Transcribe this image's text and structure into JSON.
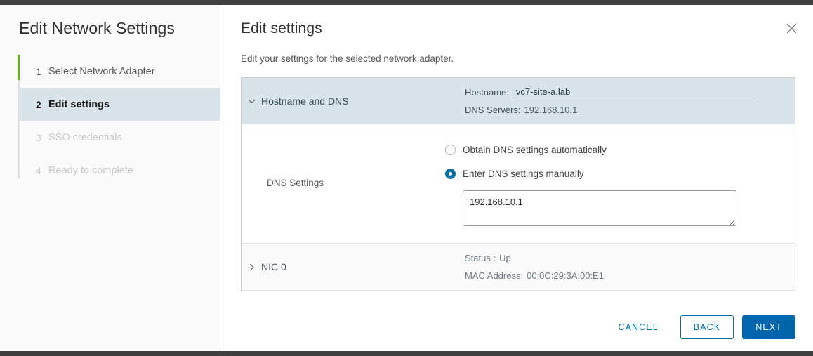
{
  "window": {
    "close_icon": "close-icon"
  },
  "wizard": {
    "title": "Edit Network Settings",
    "steps": [
      {
        "num": "1",
        "label": "Select Network Adapter",
        "state": "done"
      },
      {
        "num": "2",
        "label": "Edit settings",
        "state": "active"
      },
      {
        "num": "3",
        "label": "SSO credentials",
        "state": "upcoming"
      },
      {
        "num": "4",
        "label": "Ready to complete",
        "state": "upcoming"
      }
    ]
  },
  "content": {
    "title": "Edit settings",
    "subtitle": "Edit your settings for the selected network adapter."
  },
  "sections": {
    "hostname_dns": {
      "label": "Hostname and DNS",
      "caret_icon": "chevron-down-icon",
      "expanded": true,
      "hostname_key": "Hostname:",
      "hostname_value": "vc7-site-a.lab",
      "dns_servers_key": "DNS Servers:",
      "dns_servers_value": "192.168.10.1",
      "body": {
        "label": "DNS Settings",
        "options": [
          {
            "label": "Obtain DNS settings automatically",
            "selected": false
          },
          {
            "label": "Enter DNS settings manually",
            "selected": true
          }
        ],
        "dns_value": "192.168.10.1"
      }
    },
    "nic0": {
      "label": "NIC 0",
      "caret_icon": "chevron-right-icon",
      "expanded": false,
      "status_key": "Status :",
      "status_value": "Up",
      "mac_key": "MAC Address:",
      "mac_value": "00:0C:29:3A:00:E1"
    }
  },
  "footer": {
    "cancel": "CANCEL",
    "back": "BACK",
    "next": "NEXT"
  },
  "colors": {
    "accent_blue": "#0072a3",
    "primary_button": "#0065ab",
    "step_done_green": "#60b515",
    "active_step_bg": "#d9e4ea"
  }
}
